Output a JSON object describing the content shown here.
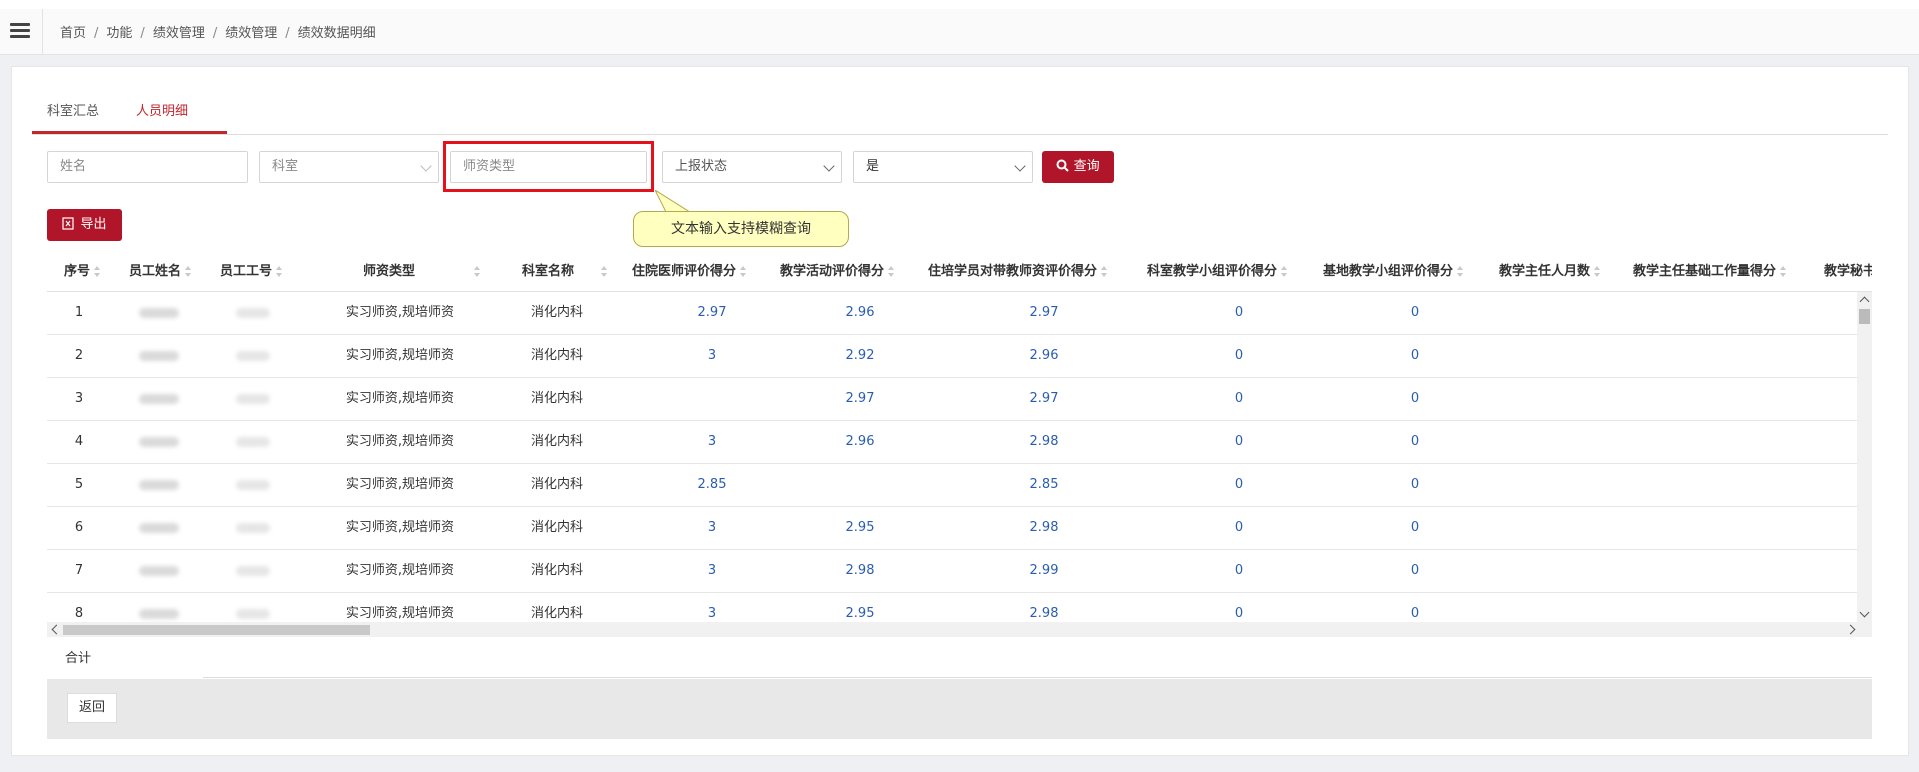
{
  "breadcrumb": [
    "首页",
    "功能",
    "绩效管理",
    "绩效管理",
    "绩效数据明细"
  ],
  "tabs": [
    {
      "label": "科室汇总"
    },
    {
      "label": "人员明细"
    }
  ],
  "filters": {
    "name_placeholder": "姓名",
    "dept_placeholder": "科室",
    "teacher_type_placeholder": "师资类型",
    "report_status": "上报状态",
    "yes_no": "是",
    "search_label": "查询"
  },
  "tooltip": "文本输入支持模糊查询",
  "export_label": "导出",
  "columns": [
    "序号",
    "员工姓名",
    "员工工号",
    "师资类型",
    "科室名称",
    "住院医师评价得分",
    "教学活动评价得分",
    "住培学员对带教师资评价得分",
    "科室教学小组评价得分",
    "基地教学小组评价得分",
    "教学主任人月数",
    "教学主任基础工作量得分",
    "教学秘书"
  ],
  "rows": [
    {
      "no": "1",
      "type": "实习师资,规培师资",
      "dept": "消化内科",
      "s1": "2.97",
      "s2": "2.96",
      "s3": "2.97",
      "s4": "0",
      "s5": "0"
    },
    {
      "no": "2",
      "type": "实习师资,规培师资",
      "dept": "消化内科",
      "s1": "3",
      "s2": "2.92",
      "s3": "2.96",
      "s4": "0",
      "s5": "0"
    },
    {
      "no": "3",
      "type": "实习师资,规培师资",
      "dept": "消化内科",
      "s1": "",
      "s2": "2.97",
      "s3": "2.97",
      "s4": "0",
      "s5": "0"
    },
    {
      "no": "4",
      "type": "实习师资,规培师资",
      "dept": "消化内科",
      "s1": "3",
      "s2": "2.96",
      "s3": "2.98",
      "s4": "0",
      "s5": "0"
    },
    {
      "no": "5",
      "type": "实习师资,规培师资",
      "dept": "消化内科",
      "s1": "2.85",
      "s2": "",
      "s3": "2.85",
      "s4": "0",
      "s5": "0"
    },
    {
      "no": "6",
      "type": "实习师资,规培师资",
      "dept": "消化内科",
      "s1": "3",
      "s2": "2.95",
      "s3": "2.98",
      "s4": "0",
      "s5": "0"
    },
    {
      "no": "7",
      "type": "实习师资,规培师资",
      "dept": "消化内科",
      "s1": "3",
      "s2": "2.98",
      "s3": "2.99",
      "s4": "0",
      "s5": "0"
    },
    {
      "no": "8",
      "type": "实习师资,规培师资",
      "dept": "消化内科",
      "s1": "3",
      "s2": "2.95",
      "s3": "2.98",
      "s4": "0",
      "s5": "0"
    }
  ],
  "total_label": "合计",
  "back_label": "返回"
}
